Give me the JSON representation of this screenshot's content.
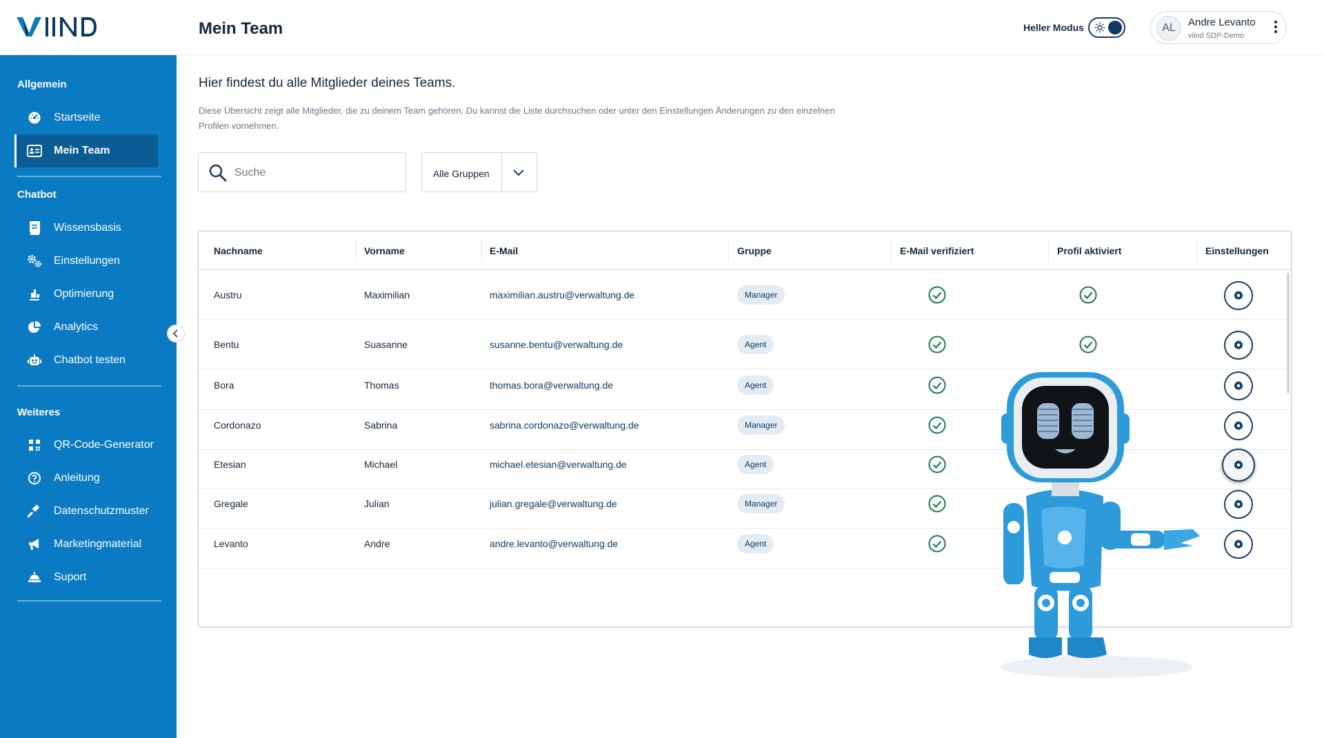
{
  "header": {
    "logo_text": "VIIND",
    "title": "Mein Team",
    "mode_label": "Heller Modus",
    "user": {
      "initials": "AL",
      "name": "Andre Levanto",
      "org": "viind SDP-Demo"
    }
  },
  "sidebar": {
    "sections": [
      {
        "title": "Allgemein",
        "items": [
          {
            "label": "Startseite",
            "icon": "dashboard-icon"
          },
          {
            "label": "Mein Team",
            "icon": "team-card-icon",
            "active": true
          }
        ]
      },
      {
        "title": "Chatbot",
        "items": [
          {
            "label": "Wissensbasis",
            "icon": "book-icon"
          },
          {
            "label": "Einstellungen",
            "icon": "gears-icon"
          },
          {
            "label": "Optimierung",
            "icon": "optimize-icon"
          },
          {
            "label": "Analytics",
            "icon": "pie-chart-icon"
          },
          {
            "label": "Chatbot testen",
            "icon": "robot-icon"
          }
        ]
      },
      {
        "title": "Weiteres",
        "items": [
          {
            "label": "QR-Code-Generator",
            "icon": "qr-code-icon"
          },
          {
            "label": "Anleitung",
            "icon": "help-icon"
          },
          {
            "label": "Datenschutzmuster",
            "icon": "gavel-icon"
          },
          {
            "label": "Marketingmaterial",
            "icon": "megaphone-icon"
          },
          {
            "label": "Suport",
            "icon": "support-icon"
          }
        ]
      }
    ]
  },
  "main": {
    "intro_title": "Hier findest du alle Mitglieder deines Teams.",
    "intro_text": "Diese Übersicht zeigt alle Mitglieder, die zu deinem Team gehören. Du kannst die Liste durchsuchen oder unter den Einstellungen Änderungen zu den einzelnen Profilen vornehmen.",
    "search": {
      "placeholder": "Suche",
      "value": ""
    },
    "group_filter": {
      "selected": "Alle Gruppen"
    }
  },
  "table": {
    "columns": [
      "Nachname",
      "Vorname",
      "E-Mail",
      "Gruppe",
      "E-Mail verifiziert",
      "Profil aktiviert",
      "Einstellungen"
    ],
    "rows": [
      {
        "last": "Austru",
        "first": "Maximilian",
        "email": "maximilian.austru@verwaltung.de",
        "group": "Manager",
        "email_verified": true,
        "profile_active": true
      },
      {
        "last": "Bentu",
        "first": "Suasanne",
        "email": "susanne.bentu@verwaltung.de",
        "group": "Agent",
        "email_verified": true,
        "profile_active": true
      },
      {
        "last": "Bora",
        "first": "Thomas",
        "email": "thomas.bora@verwaltung.de",
        "group": "Agent",
        "email_verified": true,
        "profile_active": null
      },
      {
        "last": "Cordonazo",
        "first": "Sabrina",
        "email": "sabrina.cordonazo@verwaltung.de",
        "group": "Manager",
        "email_verified": true,
        "profile_active": null
      },
      {
        "last": "Etesian",
        "first": "Michael",
        "email": "michael.etesian@verwaltung.de",
        "group": "Agent",
        "email_verified": true,
        "profile_active": null
      },
      {
        "last": "Gregale",
        "first": "Julian",
        "email": "julian.gregale@verwaltung.de",
        "group": "Manager",
        "email_verified": true,
        "profile_active": null
      },
      {
        "last": "Levanto",
        "first": "Andre",
        "email": "andre.levanto@verwaltung.de",
        "group": "Agent",
        "email_verified": true,
        "profile_active": null
      }
    ]
  },
  "colors": {
    "sidebar_bg": "#0a7ac2",
    "sidebar_active": "#0b5b94",
    "primary_dark": "#0d3a63",
    "check_green": "#1e7a4a",
    "badge_bg": "#e3ecf5"
  }
}
